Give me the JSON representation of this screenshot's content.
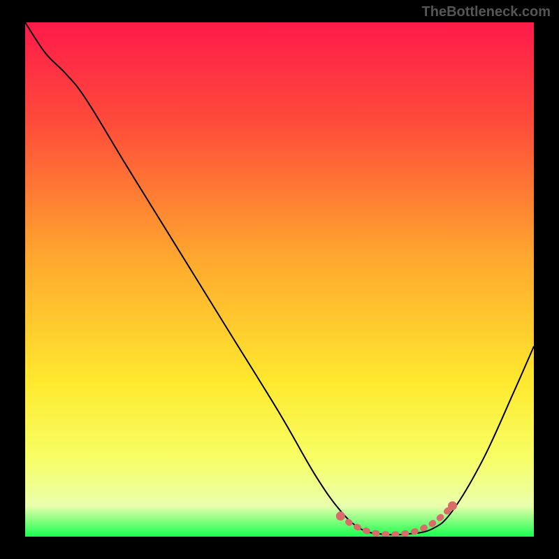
{
  "watermark": "TheBottleneck.com",
  "chart_data": {
    "type": "line",
    "title": "",
    "xlabel": "",
    "ylabel": "",
    "xlim": [
      0,
      100
    ],
    "ylim": [
      0,
      100
    ],
    "gradient_stops": [
      {
        "offset": 0,
        "color": "#ff1a4a"
      },
      {
        "offset": 20,
        "color": "#ff4d3a"
      },
      {
        "offset": 45,
        "color": "#ffa52e"
      },
      {
        "offset": 70,
        "color": "#ffe92e"
      },
      {
        "offset": 85,
        "color": "#f7ff66"
      },
      {
        "offset": 94,
        "color": "#eaffad"
      },
      {
        "offset": 100,
        "color": "#17ff4e"
      }
    ],
    "series": [
      {
        "name": "bottleneck-curve",
        "type": "line",
        "points": [
          {
            "x": 0,
            "y": 100
          },
          {
            "x": 4,
            "y": 94
          },
          {
            "x": 8,
            "y": 90
          },
          {
            "x": 12,
            "y": 85
          },
          {
            "x": 20,
            "y": 72
          },
          {
            "x": 30,
            "y": 56
          },
          {
            "x": 40,
            "y": 40
          },
          {
            "x": 50,
            "y": 24
          },
          {
            "x": 57,
            "y": 12
          },
          {
            "x": 62,
            "y": 5
          },
          {
            "x": 66,
            "y": 1.5
          },
          {
            "x": 70,
            "y": 0.5
          },
          {
            "x": 75,
            "y": 0.5
          },
          {
            "x": 80,
            "y": 1.5
          },
          {
            "x": 84,
            "y": 5
          },
          {
            "x": 90,
            "y": 15
          },
          {
            "x": 96,
            "y": 28
          },
          {
            "x": 100,
            "y": 37
          }
        ]
      },
      {
        "name": "optimal-range",
        "type": "marker-band",
        "points": [
          {
            "x": 62,
            "y": 4
          },
          {
            "x": 64,
            "y": 2.5
          },
          {
            "x": 66,
            "y": 1.5
          },
          {
            "x": 68,
            "y": 0.8
          },
          {
            "x": 70,
            "y": 0.5
          },
          {
            "x": 72,
            "y": 0.4
          },
          {
            "x": 74,
            "y": 0.5
          },
          {
            "x": 76,
            "y": 0.8
          },
          {
            "x": 78,
            "y": 1.5
          },
          {
            "x": 80,
            "y": 2.5
          },
          {
            "x": 82,
            "y": 4
          },
          {
            "x": 84,
            "y": 6
          }
        ],
        "color": "#d96b6b"
      }
    ]
  }
}
